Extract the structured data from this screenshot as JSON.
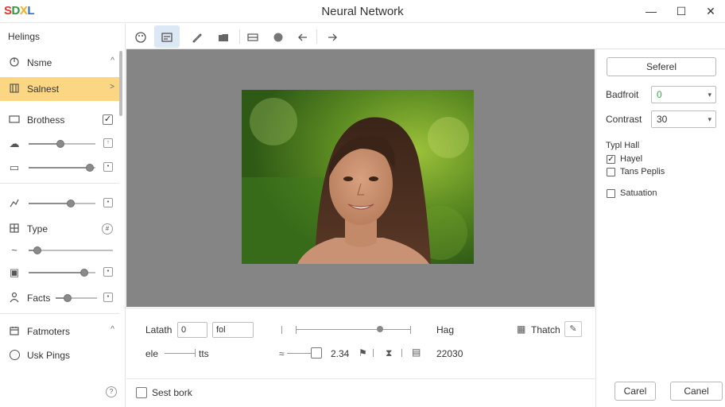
{
  "app": {
    "logo": [
      "S",
      "D",
      "X",
      "L"
    ],
    "title": "Neural Network",
    "window_buttons": {
      "minimize": "—",
      "maximize": "☐",
      "close": "✕"
    }
  },
  "left_panel": {
    "title": "Helings",
    "items": [
      {
        "label": "Nsme",
        "icon": "rotate-icon"
      },
      {
        "label": "Salnest",
        "icon": "columns-icon",
        "selected": true
      },
      {
        "label": "Brothess",
        "icon": "rectangle-icon",
        "checked": true
      },
      {
        "label": "Type",
        "icon": "grid-icon",
        "badge": "#"
      },
      {
        "label": "Facts",
        "icon": "person-icon"
      },
      {
        "label": "Fatmoters",
        "icon": "calendar-icon"
      },
      {
        "label": "Usk Pings",
        "icon": "radio-icon"
      }
    ],
    "slider_values": [
      0.45,
      0.8,
      0.55,
      0.1,
      0.7,
      0.25
    ],
    "mini_box_glyph": "•",
    "mini_box_glyph_alt": "↑",
    "help_glyph": "?"
  },
  "toolbar": {
    "icons": [
      "palette-icon",
      "image-icon",
      "brush-icon",
      "folder-icon",
      "list-icon",
      "circle-icon",
      "undo-icon",
      "redo-icon"
    ]
  },
  "bottom_panel": {
    "latath_label": "Latath",
    "latath_value": "0",
    "latath_unit": "fol",
    "hag_label": "Hag",
    "hag_slider_value": 0.8,
    "thatch_label": "Thatch",
    "elo_label": "ele",
    "tts_label": "tts",
    "num_value": "2.34",
    "count_value": "22030",
    "checkbox_label": "Sest bork"
  },
  "right_panel": {
    "top_button": "Seferel",
    "badfroit_label": "Badfroit",
    "badfroit_value": "0",
    "contrast_label": "Contrast",
    "contrast_value": "30",
    "group_label": "Typl Hall",
    "options": [
      {
        "label": "Hayel",
        "checked": true
      },
      {
        "label": "Tans Peplis",
        "checked": false
      },
      {
        "label": "Satuation",
        "checked": false
      }
    ],
    "cancel_left": "Carel",
    "cancel_right": "Canel"
  },
  "colors": {
    "accent": "#fbd784",
    "canvas": "#858585",
    "active_tool": "#dde8f5"
  }
}
